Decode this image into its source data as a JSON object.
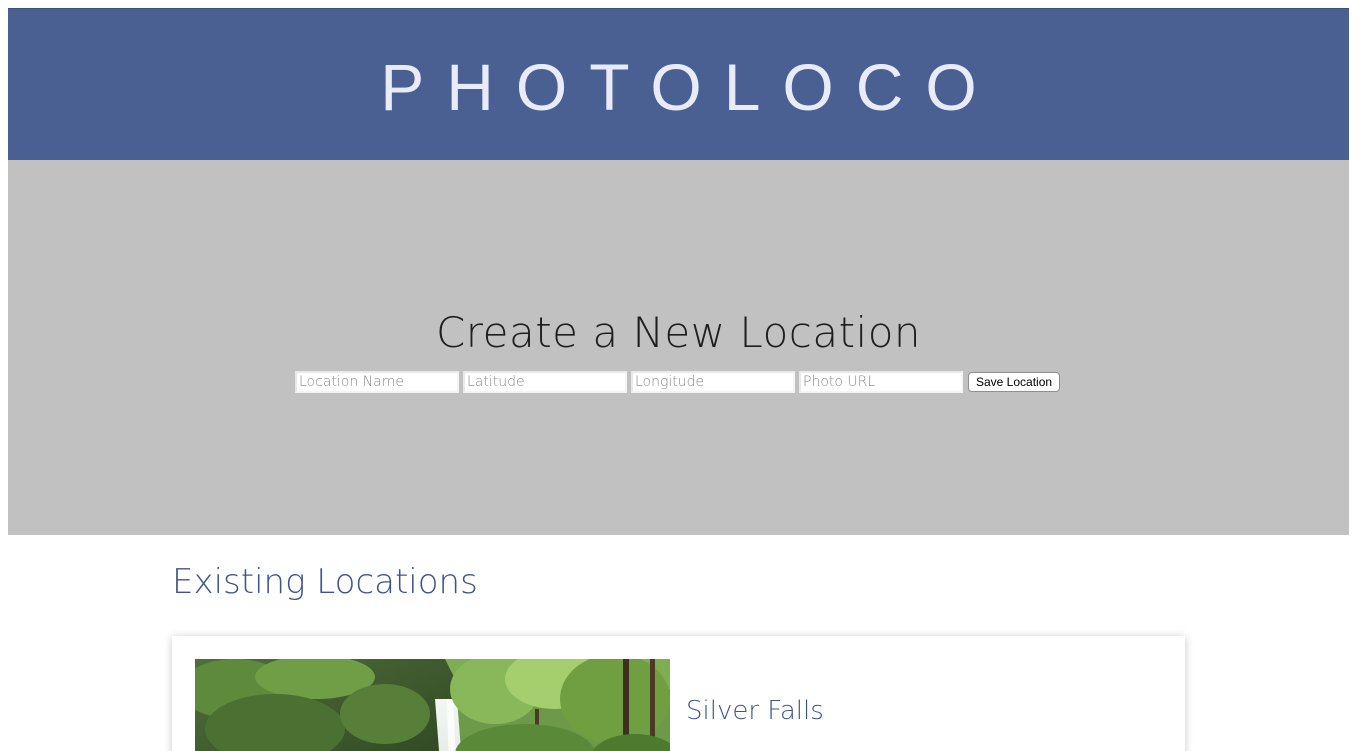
{
  "header": {
    "title": "PHOTOLOCO",
    "background_color": "#4a6092"
  },
  "create_location": {
    "heading": "Create a New Location",
    "fields": {
      "location_name": {
        "value": "",
        "placeholder": "Location Name"
      },
      "latitude": {
        "value": "",
        "placeholder": "Latitude"
      },
      "longitude": {
        "value": "",
        "placeholder": "Longitude"
      },
      "photo_url": {
        "value": "",
        "placeholder": "Photo URL"
      }
    },
    "save_label": "Save Location",
    "background_color": "#c1c1c1"
  },
  "existing_locations": {
    "heading": "Existing Locations",
    "items": [
      {
        "name": "Silver Falls",
        "photo_icon": "waterfall-photo"
      }
    ]
  },
  "colors": {
    "accent": "#3e5488",
    "page_background": "#ffffff"
  }
}
